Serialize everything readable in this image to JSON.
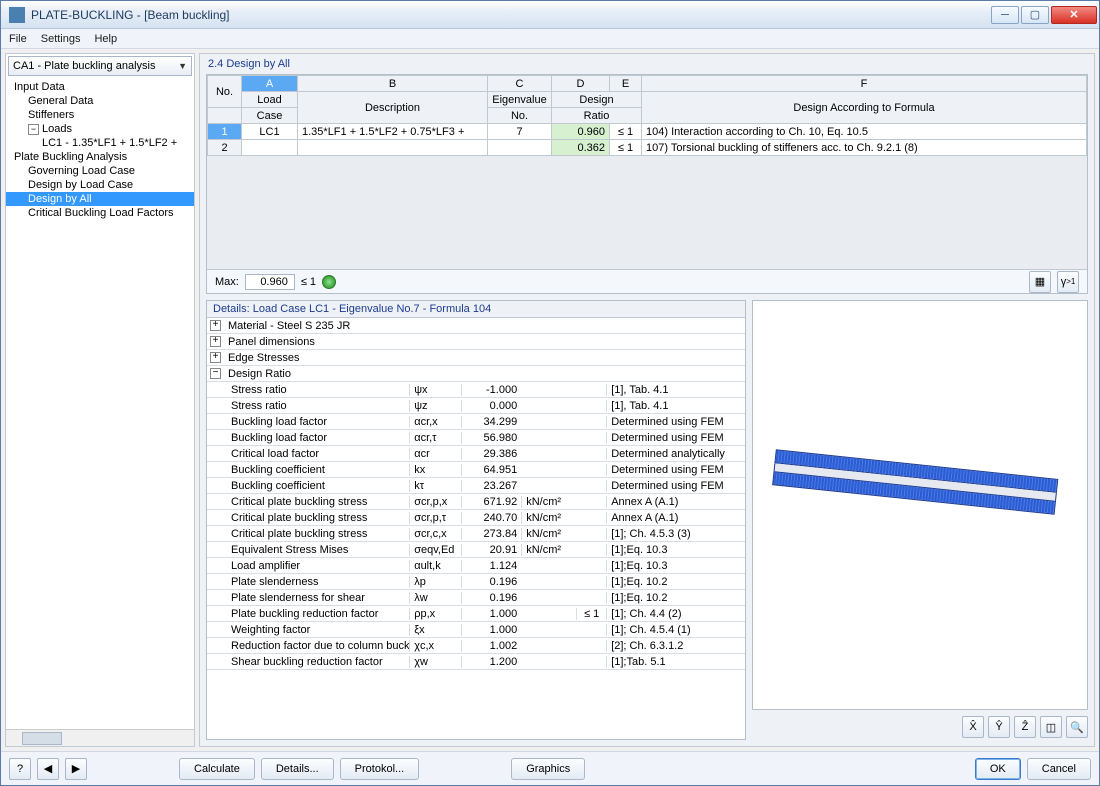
{
  "window": {
    "title": "PLATE-BUCKLING - [Beam buckling]"
  },
  "menu": {
    "file": "File",
    "settings": "Settings",
    "help": "Help"
  },
  "sidebar": {
    "combo": "CA1 - Plate buckling analysis",
    "input_data": "Input Data",
    "general_data": "General Data",
    "stiffeners": "Stiffeners",
    "loads": "Loads",
    "lc1": "LC1 - 1.35*LF1 + 1.5*LF2 +",
    "pba": "Plate Buckling Analysis",
    "gov": "Governing Load Case",
    "dblc": "Design by Load Case",
    "dba": "Design by All",
    "cblf": "Critical Buckling Load Factors"
  },
  "panel": {
    "title": "2.4 Design by All"
  },
  "grid": {
    "cols": {
      "A": "A",
      "B": "B",
      "C": "C",
      "D": "D",
      "E": "E",
      "F": "F"
    },
    "h2": {
      "no": "No.",
      "load": "Load",
      "case": "Case",
      "desc": "Description",
      "ev": "Eigenvalue",
      "evno": "No.",
      "design": "Design",
      "ratio": "Ratio",
      "daf": "Design According to Formula"
    },
    "rows": [
      {
        "no": "1",
        "lc": "LC1",
        "desc": "1.35*LF1 + 1.5*LF2 + 0.75*LF3 + ",
        "ev": "7",
        "ratio": "0.960",
        "cond": "≤ 1",
        "formula": "104) Interaction according to Ch. 10, Eq. 10.5"
      },
      {
        "no": "2",
        "lc": "",
        "desc": "",
        "ev": "",
        "ratio": "0.362",
        "cond": "≤ 1",
        "formula": "107) Torsional buckling of stiffeners acc. to Ch. 9.2.1 (8)"
      }
    ],
    "max_label": "Max:",
    "max_val": "0.960",
    "max_cond": "≤ 1"
  },
  "details": {
    "title": "Details:  Load Case LC1 - Eigenvalue No.7 - Formula 104",
    "groups": {
      "mat": "Material - Steel S 235 JR",
      "panel": "Panel dimensions",
      "edge": "Edge Stresses",
      "design": "Design Ratio"
    },
    "rows": [
      {
        "n": "Stress ratio",
        "s": "ψx",
        "v": "-1.000",
        "u": "",
        "c": "",
        "r": "[1], Tab. 4.1"
      },
      {
        "n": "Stress ratio",
        "s": "ψz",
        "v": "0.000",
        "u": "",
        "c": "",
        "r": "[1], Tab. 4.1"
      },
      {
        "n": "Buckling load factor",
        "s": "αcr,x",
        "v": "34.299",
        "u": "",
        "c": "",
        "r": "Determined using FEM"
      },
      {
        "n": "Buckling load factor",
        "s": "αcr,τ",
        "v": "56.980",
        "u": "",
        "c": "",
        "r": "Determined using FEM"
      },
      {
        "n": "Critical load factor",
        "s": "αcr",
        "v": "29.386",
        "u": "",
        "c": "",
        "r": "Determined analytically"
      },
      {
        "n": "Buckling coefficient",
        "s": "kx",
        "v": "64.951",
        "u": "",
        "c": "",
        "r": "Determined using FEM"
      },
      {
        "n": "Buckling coefficient",
        "s": "kτ",
        "v": "23.267",
        "u": "",
        "c": "",
        "r": "Determined using FEM"
      },
      {
        "n": "Critical plate buckling stress",
        "s": "σcr,p,x",
        "v": "671.92",
        "u": "kN/cm²",
        "c": "",
        "r": "Annex A (A.1)"
      },
      {
        "n": "Critical plate buckling stress",
        "s": "σcr,p,τ",
        "v": "240.70",
        "u": "kN/cm²",
        "c": "",
        "r": "Annex A (A.1)"
      },
      {
        "n": "Critical plate buckling stress",
        "s": "σcr,c,x",
        "v": "273.84",
        "u": "kN/cm²",
        "c": "",
        "r": "[1]; Ch. 4.5.3 (3)"
      },
      {
        "n": "Equivalent Stress Mises",
        "s": "σeqv,Ed",
        "v": "20.91",
        "u": "kN/cm²",
        "c": "",
        "r": "[1];Eq. 10.3"
      },
      {
        "n": "Load amplifier",
        "s": "αult,k",
        "v": "1.124",
        "u": "",
        "c": "",
        "r": "[1];Eq. 10.3"
      },
      {
        "n": "Plate slenderness",
        "s": "λp",
        "v": "0.196",
        "u": "",
        "c": "",
        "r": "[1];Eq. 10.2"
      },
      {
        "n": "Plate slenderness for shear",
        "s": "λw",
        "v": "0.196",
        "u": "",
        "c": "",
        "r": "[1];Eq. 10.2"
      },
      {
        "n": "Plate buckling reduction factor",
        "s": "ρp,x",
        "v": "1.000",
        "u": "",
        "c": "≤ 1",
        "r": "[1]; Ch. 4.4 (2)"
      },
      {
        "n": "Weighting factor",
        "s": "ξx",
        "v": "1.000",
        "u": "",
        "c": "",
        "r": "[1]; Ch. 4.5.4 (1)"
      },
      {
        "n": "Reduction factor due to column buckling",
        "s": "χc,x",
        "v": "1.002",
        "u": "",
        "c": "",
        "r": "[2]; Ch. 6.3.1.2"
      },
      {
        "n": "Shear buckling reduction factor",
        "s": "χw",
        "v": "1.200",
        "u": "",
        "c": "",
        "r": "[1];Tab. 5.1"
      }
    ]
  },
  "footer": {
    "calculate": "Calculate",
    "details": "Details...",
    "protokol": "Protokol...",
    "graphics": "Graphics",
    "ok": "OK",
    "cancel": "Cancel"
  }
}
